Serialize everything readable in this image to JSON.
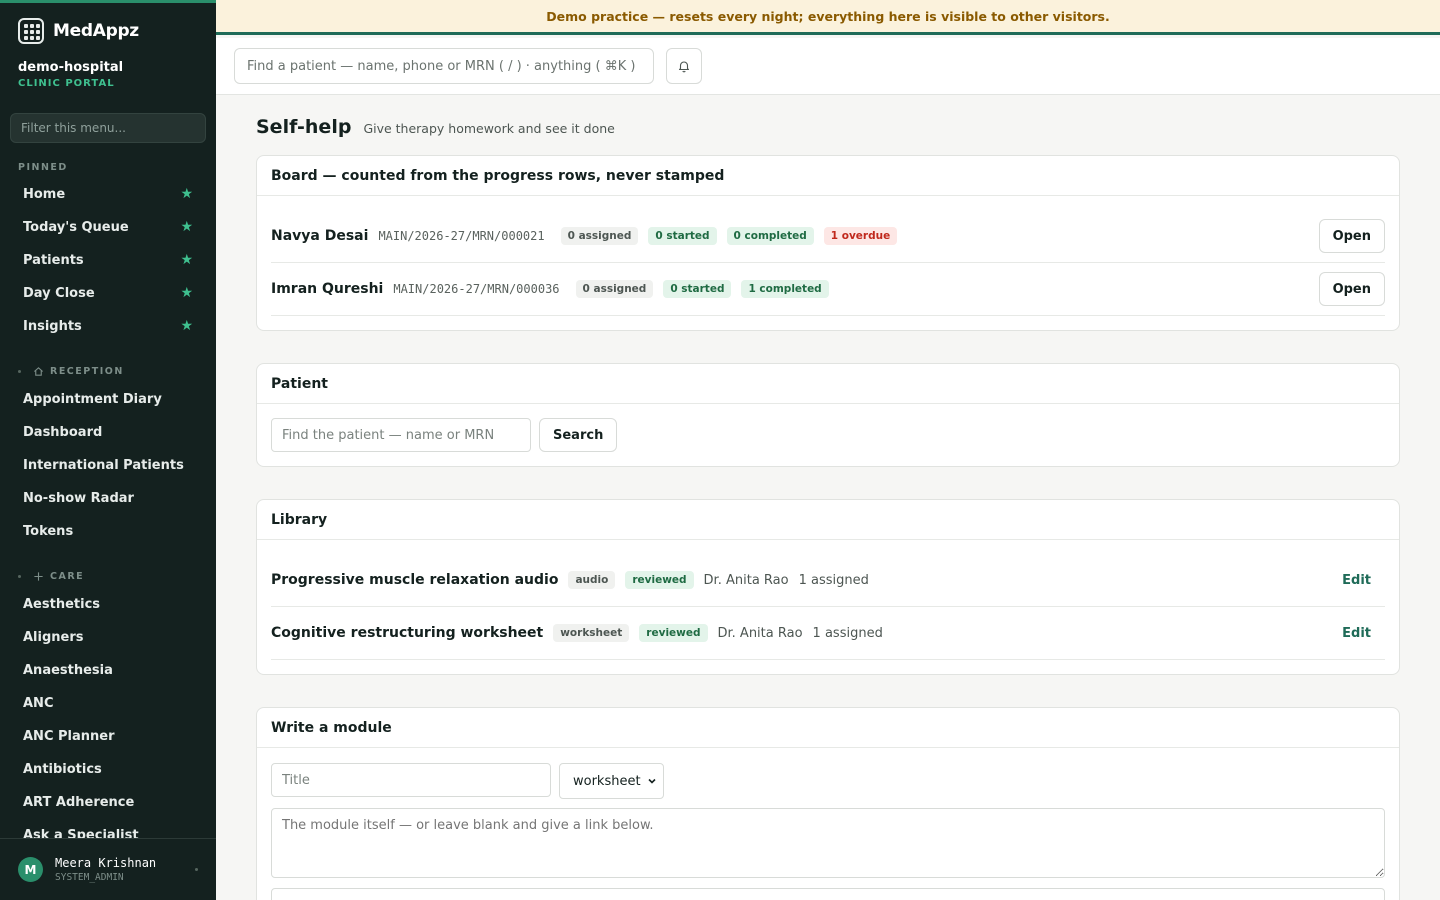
{
  "app": {
    "brand": "MedAppz",
    "tenant": "demo-hospital",
    "portal": "CLINIC PORTAL",
    "menu_filter_placeholder": "Filter this menu..."
  },
  "sidebar": {
    "pinned_label": "PINNED",
    "pinned": [
      {
        "label": "Home"
      },
      {
        "label": "Today's Queue"
      },
      {
        "label": "Patients"
      },
      {
        "label": "Day Close"
      },
      {
        "label": "Insights"
      }
    ],
    "reception_label": "RECEPTION",
    "reception": [
      {
        "label": "Appointment Diary"
      },
      {
        "label": "Dashboard"
      },
      {
        "label": "International Patients"
      },
      {
        "label": "No-show Radar"
      },
      {
        "label": "Tokens"
      }
    ],
    "care_label": "CARE",
    "care": [
      {
        "label": "Aesthetics"
      },
      {
        "label": "Aligners"
      },
      {
        "label": "Anaesthesia"
      },
      {
        "label": "ANC"
      },
      {
        "label": "ANC Planner"
      },
      {
        "label": "Antibiotics"
      },
      {
        "label": "ART Adherence"
      },
      {
        "label": "Ask a Specialist"
      }
    ],
    "user": {
      "initial": "M",
      "name": "Meera Krishnan",
      "role": "SYSTEM_ADMIN"
    }
  },
  "banner": {
    "text": "Demo practice — resets every night; everything here is visible to other visitors."
  },
  "topbar": {
    "search_placeholder": "Find a patient — name, phone or MRN ( / ) · anything ( ⌘K )"
  },
  "page": {
    "title": "Self-help",
    "subtitle": "Give therapy homework and see it done"
  },
  "board": {
    "title": "Board — counted from the progress rows, never stamped",
    "rows": [
      {
        "name": "Navya Desai",
        "mrn": "MAIN/2026-27/MRN/000021",
        "assigned": "0 assigned",
        "started": "0 started",
        "completed": "0 completed",
        "overdue": "1 overdue",
        "action": "Open"
      },
      {
        "name": "Imran Qureshi",
        "mrn": "MAIN/2026-27/MRN/000036",
        "assigned": "0 assigned",
        "started": "0 started",
        "completed": "1 completed",
        "action": "Open"
      }
    ]
  },
  "patient": {
    "title": "Patient",
    "search_placeholder": "Find the patient — name or MRN",
    "search_button": "Search"
  },
  "library": {
    "title": "Library",
    "items": [
      {
        "title": "Progressive muscle relaxation audio",
        "kind": "audio",
        "status": "reviewed",
        "author": "Dr. Anita Rao",
        "assigned": "1 assigned",
        "action": "Edit"
      },
      {
        "title": "Cognitive restructuring worksheet",
        "kind": "worksheet",
        "status": "reviewed",
        "author": "Dr. Anita Rao",
        "assigned": "1 assigned",
        "action": "Edit"
      }
    ]
  },
  "write_module": {
    "title": "Write a module",
    "title_placeholder": "Title",
    "type_value": "worksheet",
    "body_placeholder": "The module itself — or leave blank and give a link below."
  },
  "colors": {
    "sidebar_bg": "#14211f",
    "accent": "#2a8f6b",
    "banner_bg": "#fbf2dc",
    "banner_text": "#8a5a00"
  }
}
